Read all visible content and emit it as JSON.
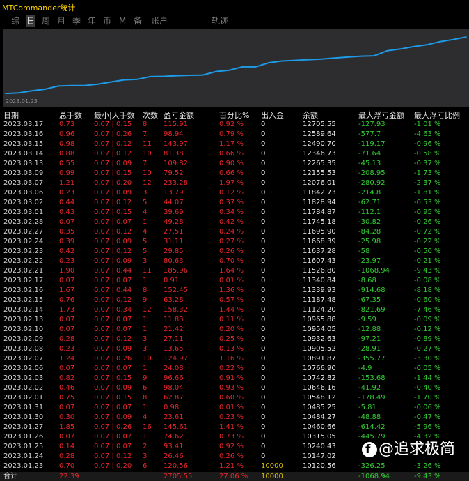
{
  "app": {
    "title": "MTCommander统计"
  },
  "tabs": [
    {
      "label": "综",
      "active": false
    },
    {
      "label": "日",
      "active": true
    },
    {
      "label": "周",
      "active": false
    },
    {
      "label": "月",
      "active": false
    },
    {
      "label": "季",
      "active": false
    },
    {
      "label": "年",
      "active": false
    },
    {
      "label": "币",
      "active": false
    },
    {
      "label": "M",
      "active": false
    },
    {
      "label": "备",
      "active": false
    },
    {
      "label": "账户",
      "active": false
    },
    {
      "label": "轨迹",
      "active": false
    }
  ],
  "chart_data": {
    "type": "area",
    "x_start_label": "2023.01.23",
    "x": [
      "2023.01.23",
      "2023.01.24",
      "2023.01.25",
      "2023.01.26",
      "2023.01.27",
      "2023.01.30",
      "2023.01.31",
      "2023.02.01",
      "2023.02.02",
      "2023.02.03",
      "2023.02.06",
      "2023.02.07",
      "2023.02.08",
      "2023.02.09",
      "2023.02.10",
      "2023.02.13",
      "2023.02.14",
      "2023.02.15",
      "2023.02.16",
      "2023.02.17",
      "2023.02.21",
      "2023.02.22",
      "2023.02.23",
      "2023.02.24",
      "2023.02.27",
      "2023.02.28",
      "2023.03.01",
      "2023.03.02",
      "2023.03.06",
      "2023.03.07",
      "2023.03.09",
      "2023.03.13",
      "2023.03.14",
      "2023.03.15",
      "2023.03.16",
      "2023.03.17"
    ],
    "values": [
      10120.56,
      10147.02,
      10240.43,
      10315.05,
      10460.66,
      10484.27,
      10485.25,
      10548.12,
      10646.16,
      10742.82,
      10766.9,
      10891.87,
      10905.52,
      10932.63,
      10954.05,
      10965.88,
      11124.2,
      11187.48,
      11339.93,
      11340.84,
      11526.8,
      11607.43,
      11637.28,
      11668.39,
      11695.9,
      11745.18,
      11784.87,
      11828.94,
      11842.73,
      12076.01,
      12155.53,
      12265.35,
      12346.73,
      12490.7,
      12589.64,
      12705.55
    ],
    "ylim": [
      9900,
      12900
    ],
    "colors": {
      "line": "#1e9be8",
      "background": "#2d2d30"
    }
  },
  "table": {
    "headers": [
      "日期",
      "总手数",
      "最小|大手数",
      "次数",
      "盈亏金额",
      "百分比%",
      "出入金",
      "余额",
      "最大浮亏金额",
      "最大浮亏比例"
    ],
    "rows": [
      [
        "2023.03.17",
        "0.73",
        "0.07 | 0.15",
        "8",
        "115.91",
        "0.92 %",
        "0",
        "12705.55",
        "-127.93",
        "-1.01 %"
      ],
      [
        "2023.03.16",
        "0.96",
        "0.07 | 0.26",
        "7",
        "98.94",
        "0.79 %",
        "0",
        "12589.64",
        "-577.7",
        "-4.63 %"
      ],
      [
        "2023.03.15",
        "0.98",
        "0.07 | 0.12",
        "11",
        "143.97",
        "1.17 %",
        "0",
        "12490.70",
        "-119.17",
        "-0.96 %"
      ],
      [
        "2023.03.14",
        "0.88",
        "0.07 | 0.12",
        "10",
        "81.38",
        "0.66 %",
        "0",
        "12346.73",
        "-71.64",
        "-0.58 %"
      ],
      [
        "2023.03.13",
        "0.55",
        "0.07 | 0.09",
        "7",
        "109.82",
        "0.90 %",
        "0",
        "12265.35",
        "-45.13",
        "-0.37 %"
      ],
      [
        "2023.03.09",
        "0.99",
        "0.07 | 0.15",
        "10",
        "79.52",
        "0.66 %",
        "0",
        "12155.53",
        "-208.95",
        "-1.73 %"
      ],
      [
        "2023.03.07",
        "1.21",
        "0.07 | 0.20",
        "12",
        "233.28",
        "1.97 %",
        "0",
        "12076.01",
        "-280.92",
        "-2.37 %"
      ],
      [
        "2023.03.06",
        "0.23",
        "0.07 | 0.09",
        "3",
        "13.79",
        "0.12 %",
        "0",
        "11842.73",
        "-214.8",
        "-1.81 %"
      ],
      [
        "2023.03.02",
        "0.44",
        "0.07 | 0.12",
        "5",
        "44.07",
        "0.37 %",
        "0",
        "11828.94",
        "-62.71",
        "-0.53 %"
      ],
      [
        "2023.03.01",
        "0.43",
        "0.07 | 0.15",
        "4",
        "39.69",
        "0.34 %",
        "0",
        "11784.87",
        "-112.1",
        "-0.95 %"
      ],
      [
        "2023.02.28",
        "0.07",
        "0.07 | 0.07",
        "1",
        "49.28",
        "0.42 %",
        "0",
        "11745.18",
        "-30.82",
        "-0.26 %"
      ],
      [
        "2023.02.27",
        "0.35",
        "0.07 | 0.12",
        "4",
        "27.51",
        "0.24 %",
        "0",
        "11695.90",
        "-84.28",
        "-0.72 %"
      ],
      [
        "2023.02.24",
        "0.39",
        "0.07 | 0.09",
        "5",
        "31.11",
        "0.27 %",
        "0",
        "11668.39",
        "-25.98",
        "-0.22 %"
      ],
      [
        "2023.02.23",
        "0.42",
        "0.07 | 0.12",
        "5",
        "29.85",
        "0.26 %",
        "0",
        "11637.28",
        "-58",
        "-0.50 %"
      ],
      [
        "2023.02.22",
        "0.23",
        "0.07 | 0.09",
        "3",
        "80.63",
        "0.70 %",
        "0",
        "11607.43",
        "-23.97",
        "-0.21 %"
      ],
      [
        "2023.02.21",
        "1.90",
        "0.07 | 0.44",
        "11",
        "185.96",
        "1.64 %",
        "0",
        "11526.80",
        "-1068.94",
        "-9.43 %"
      ],
      [
        "2023.02.17",
        "0.07",
        "0.07 | 0.07",
        "1",
        "0.91",
        "0.01 %",
        "0",
        "11340.84",
        "-8.68",
        "-0.08 %"
      ],
      [
        "2023.02.16",
        "1.67",
        "0.07 | 0.44",
        "8",
        "152.45",
        "1.36 %",
        "0",
        "11339.93",
        "-914.68",
        "-8.18 %"
      ],
      [
        "2023.02.15",
        "0.76",
        "0.07 | 0.12",
        "9",
        "63.28",
        "0.57 %",
        "0",
        "11187.48",
        "-67.35",
        "-0.60 %"
      ],
      [
        "2023.02.14",
        "1.73",
        "0.07 | 0.34",
        "12",
        "158.32",
        "1.44 %",
        "0",
        "11124.20",
        "-821.69",
        "-7.46 %"
      ],
      [
        "2023.02.13",
        "0.07",
        "0.07 | 0.07",
        "1",
        "11.83",
        "0.11 %",
        "0",
        "10965.88",
        "-9.59",
        "-0.09 %"
      ],
      [
        "2023.02.10",
        "0.07",
        "0.07 | 0.07",
        "1",
        "21.42",
        "0.20 %",
        "0",
        "10954.05",
        "-12.88",
        "-0.12 %"
      ],
      [
        "2023.02.09",
        "0.28",
        "0.07 | 0.12",
        "3",
        "27.11",
        "0.25 %",
        "0",
        "10932.63",
        "-97.21",
        "-0.89 %"
      ],
      [
        "2023.02.08",
        "0.23",
        "0.07 | 0.09",
        "3",
        "13.65",
        "0.13 %",
        "0",
        "10905.52",
        "-28.91",
        "-0.27 %"
      ],
      [
        "2023.02.07",
        "1.24",
        "0.07 | 0.26",
        "10",
        "124.97",
        "1.16 %",
        "0",
        "10891.87",
        "-355.77",
        "-3.30 %"
      ],
      [
        "2023.02.06",
        "0.07",
        "0.07 | 0.07",
        "1",
        "24.08",
        "0.22 %",
        "0",
        "10766.90",
        "-4.9",
        "-0.05 %"
      ],
      [
        "2023.02.03",
        "0.82",
        "0.07 | 0.15",
        "9",
        "96.66",
        "0.91 %",
        "0",
        "10742.82",
        "-153.68",
        "-1.44 %"
      ],
      [
        "2023.02.02",
        "0.46",
        "0.07 | 0.09",
        "6",
        "98.04",
        "0.93 %",
        "0",
        "10646.16",
        "-41.92",
        "-0.40 %"
      ],
      [
        "2023.02.01",
        "0.75",
        "0.07 | 0.15",
        "8",
        "62.87",
        "0.60 %",
        "0",
        "10548.12",
        "-178.49",
        "-1.70 %"
      ],
      [
        "2023.01.31",
        "0.07",
        "0.07 | 0.07",
        "1",
        "0.98",
        "0.01 %",
        "0",
        "10485.25",
        "-5.81",
        "-0.06 %"
      ],
      [
        "2023.01.30",
        "0.30",
        "0.07 | 0.09",
        "4",
        "23.61",
        "0.23 %",
        "0",
        "10484.27",
        "-48.88",
        "-0.47 %"
      ],
      [
        "2023.01.27",
        "1.85",
        "0.07 | 0.26",
        "16",
        "145.61",
        "1.41 %",
        "0",
        "10460.66",
        "-614.42",
        "-5.96 %"
      ],
      [
        "2023.01.26",
        "0.07",
        "0.07 | 0.07",
        "1",
        "74.62",
        "0.73 %",
        "0",
        "10315.05",
        "-445.79",
        "-4.32 %"
      ],
      [
        "2023.01.25",
        "0.14",
        "0.07 | 0.07",
        "2",
        "93.41",
        "0.92 %",
        "0",
        "10240.43",
        "",
        ""
      ],
      [
        "2023.01.24",
        "0.28",
        "0.07 | 0.12",
        "3",
        "26.46",
        "0.26 %",
        "0",
        "10147.02",
        "",
        ""
      ],
      [
        "2023.01.23",
        "0.70",
        "0.07 | 0.20",
        "6",
        "120.56",
        "1.21 %",
        "10000",
        "10120.56",
        "-326.25",
        "-3.26 %"
      ]
    ],
    "total": {
      "label": "合计",
      "lots": "22.39",
      "profit": "2705.55",
      "percent": "27.06 %",
      "deposit": "10000",
      "max_float_loss": "-1068.94",
      "max_float_ratio": "-9.43 %"
    }
  },
  "watermark": {
    "text": "@追求极简"
  }
}
